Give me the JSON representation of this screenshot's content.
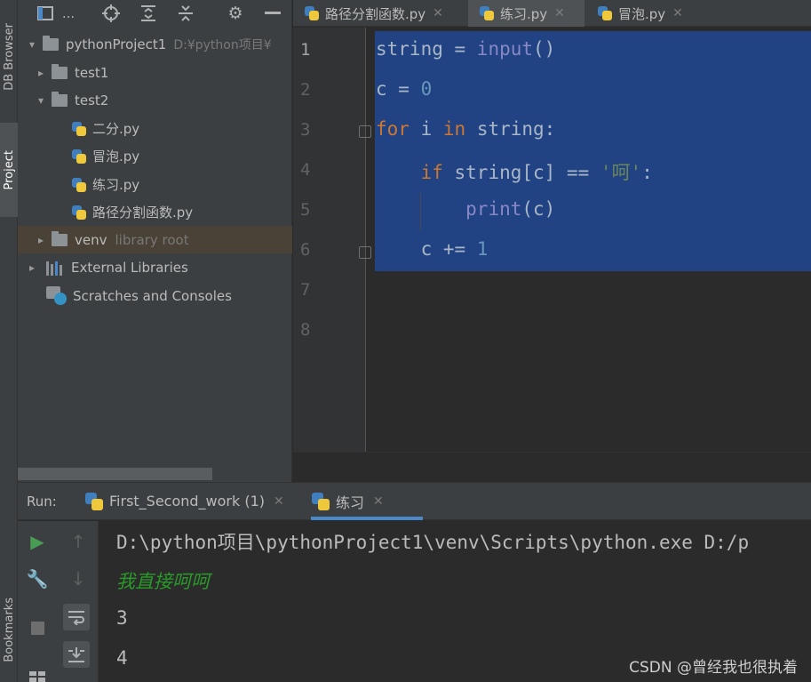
{
  "left_strip": {
    "db_browser": "DB Browser",
    "project": "Project",
    "bookmarks": "Bookmarks"
  },
  "project_panel": {
    "title_ellipsis": "...",
    "tree": [
      {
        "label": "pythonProject1",
        "hint": "D:¥python项目¥",
        "type": "folder",
        "expanded": true
      },
      {
        "label": "test1",
        "type": "folder",
        "expanded": false
      },
      {
        "label": "test2",
        "type": "folder",
        "expanded": true
      },
      {
        "label": "二分.py",
        "type": "python"
      },
      {
        "label": "冒泡.py",
        "type": "python"
      },
      {
        "label": "练习.py",
        "type": "python"
      },
      {
        "label": "路径分割函数.py",
        "type": "python"
      },
      {
        "label": "venv",
        "hint": "library root",
        "type": "folder",
        "expanded": false,
        "selected": true
      },
      {
        "label": "External Libraries",
        "type": "libraries",
        "expanded": false
      },
      {
        "label": "Scratches and Consoles",
        "type": "scratches"
      }
    ]
  },
  "editor_tabs": [
    {
      "label": "路径分割函数.py",
      "active": false
    },
    {
      "label": "练习.py",
      "active": true
    },
    {
      "label": "冒泡.py",
      "active": false
    }
  ],
  "editor": {
    "line_numbers": [
      "1",
      "2",
      "3",
      "4",
      "5",
      "6",
      "7",
      "8"
    ],
    "code": {
      "l1": {
        "a": "string",
        "b": " = ",
        "c": "input",
        "d": "()"
      },
      "l2": {
        "a": "c = ",
        "b": "0"
      },
      "l3": {
        "a": "for",
        "b": " i ",
        "c": "in",
        "d": " string:"
      },
      "l4": {
        "a": "    ",
        "b": "if",
        "c": " string[c] == ",
        "d": "'呵'",
        "e": ":"
      },
      "l5": {
        "a": "        ",
        "b": "print",
        "c": "(c)"
      },
      "l6": {
        "a": "    c += ",
        "b": "1"
      }
    }
  },
  "run": {
    "label": "Run:",
    "tabs": [
      {
        "label": "First_Second_work (1)",
        "active": false
      },
      {
        "label": "练习",
        "active": true
      }
    ],
    "console": [
      {
        "text": "D:\\python项目\\pythonProject1\\venv\\Scripts\\python.exe D:/p",
        "kind": "cmd"
      },
      {
        "text": "我直接呵呵",
        "kind": "input"
      },
      {
        "text": "3",
        "kind": "output"
      },
      {
        "text": "4",
        "kind": "output"
      }
    ]
  },
  "watermark": "CSDN @曾经我也很执着",
  "colors": {
    "selection": "#214283",
    "keyword": "#cc7832",
    "builtin": "#8888c6",
    "number": "#6897bb",
    "string": "#6a8759",
    "console_input": "#299a29"
  }
}
